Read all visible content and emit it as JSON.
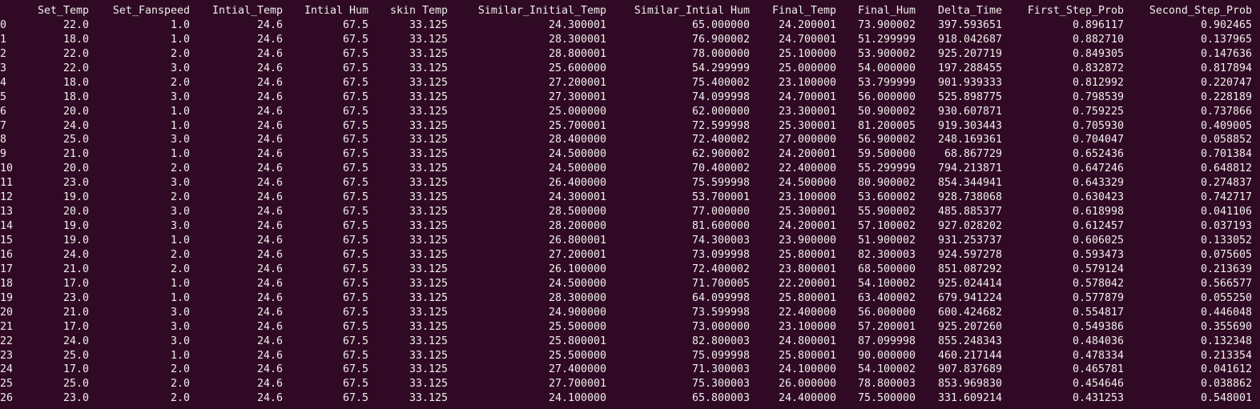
{
  "terminal": {
    "columns": [
      "Set_Temp",
      "Set_Fanspeed",
      "Intial_Temp",
      "Intial Hum",
      "skin Temp",
      "Similar_Initial_Temp",
      "Similar_Intial Hum",
      "Final_Temp",
      "Final_Hum",
      "Delta_Time",
      "First_Step_Prob",
      "Second_Step_Prob"
    ],
    "rows": [
      [
        "0",
        "22.0",
        "1.0",
        "24.6",
        "67.5",
        "33.125",
        "24.300001",
        "65.000000",
        "24.200001",
        "73.900002",
        "397.593651",
        "0.896117",
        "0.902465"
      ],
      [
        "1",
        "18.0",
        "1.0",
        "24.6",
        "67.5",
        "33.125",
        "28.300001",
        "76.900002",
        "24.700001",
        "51.299999",
        "918.042687",
        "0.882710",
        "0.137965"
      ],
      [
        "2",
        "22.0",
        "2.0",
        "24.6",
        "67.5",
        "33.125",
        "28.800001",
        "78.000000",
        "25.100000",
        "53.900002",
        "925.207719",
        "0.849305",
        "0.147636"
      ],
      [
        "3",
        "22.0",
        "3.0",
        "24.6",
        "67.5",
        "33.125",
        "25.600000",
        "54.299999",
        "25.000000",
        "54.000000",
        "197.288455",
        "0.832872",
        "0.817894"
      ],
      [
        "4",
        "18.0",
        "2.0",
        "24.6",
        "67.5",
        "33.125",
        "27.200001",
        "75.400002",
        "23.100000",
        "53.799999",
        "901.939333",
        "0.812992",
        "0.220747"
      ],
      [
        "5",
        "18.0",
        "3.0",
        "24.6",
        "67.5",
        "33.125",
        "27.300001",
        "74.099998",
        "24.700001",
        "56.000000",
        "525.898775",
        "0.798539",
        "0.228189"
      ],
      [
        "6",
        "20.0",
        "1.0",
        "24.6",
        "67.5",
        "33.125",
        "25.000000",
        "62.000000",
        "23.300001",
        "50.900002",
        "930.607871",
        "0.759225",
        "0.737866"
      ],
      [
        "7",
        "24.0",
        "1.0",
        "24.6",
        "67.5",
        "33.125",
        "25.700001",
        "72.599998",
        "25.300001",
        "81.200005",
        "919.303443",
        "0.705930",
        "0.409005"
      ],
      [
        "8",
        "25.0",
        "3.0",
        "24.6",
        "67.5",
        "33.125",
        "28.400000",
        "72.400002",
        "27.000000",
        "56.900002",
        "248.169361",
        "0.704047",
        "0.058852"
      ],
      [
        "9",
        "21.0",
        "1.0",
        "24.6",
        "67.5",
        "33.125",
        "24.500000",
        "62.900002",
        "24.200001",
        "59.500000",
        " 68.867729",
        "0.652436",
        "0.701384"
      ],
      [
        "10",
        "20.0",
        "2.0",
        "24.6",
        "67.5",
        "33.125",
        "24.500000",
        "70.400002",
        "22.400000",
        "55.299999",
        "794.213871",
        "0.647246",
        "0.648812"
      ],
      [
        "11",
        "23.0",
        "3.0",
        "24.6",
        "67.5",
        "33.125",
        "26.400000",
        "75.599998",
        "24.500000",
        "80.900002",
        "854.344941",
        "0.643329",
        "0.274837"
      ],
      [
        "12",
        "19.0",
        "2.0",
        "24.6",
        "67.5",
        "33.125",
        "24.300001",
        "53.700001",
        "23.100000",
        "53.600002",
        "928.738068",
        "0.630423",
        "0.742717"
      ],
      [
        "13",
        "20.0",
        "3.0",
        "24.6",
        "67.5",
        "33.125",
        "28.500000",
        "77.000000",
        "25.300001",
        "55.900002",
        "485.885377",
        "0.618998",
        "0.041106"
      ],
      [
        "14",
        "19.0",
        "3.0",
        "24.6",
        "67.5",
        "33.125",
        "28.200000",
        "81.600000",
        "24.200001",
        "57.100002",
        "927.028202",
        "0.612457",
        "0.037193"
      ],
      [
        "15",
        "19.0",
        "1.0",
        "24.6",
        "67.5",
        "33.125",
        "26.800001",
        "74.300003",
        "23.900000",
        "51.900002",
        "931.253737",
        "0.606025",
        "0.133052"
      ],
      [
        "16",
        "24.0",
        "2.0",
        "24.6",
        "67.5",
        "33.125",
        "27.200001",
        "73.099998",
        "25.800001",
        "82.300003",
        "924.597278",
        "0.593473",
        "0.075605"
      ],
      [
        "17",
        "21.0",
        "2.0",
        "24.6",
        "67.5",
        "33.125",
        "26.100000",
        "72.400002",
        "23.800001",
        "68.500000",
        "851.087292",
        "0.579124",
        "0.213639"
      ],
      [
        "18",
        "17.0",
        "1.0",
        "24.6",
        "67.5",
        "33.125",
        "24.500000",
        "71.700005",
        "22.200001",
        "54.100002",
        "925.024414",
        "0.578042",
        "0.566577"
      ],
      [
        "19",
        "23.0",
        "1.0",
        "24.6",
        "67.5",
        "33.125",
        "28.300000",
        "64.099998",
        "25.800001",
        "63.400002",
        "679.941224",
        "0.577879",
        "0.055250"
      ],
      [
        "20",
        "21.0",
        "3.0",
        "24.6",
        "67.5",
        "33.125",
        "24.900000",
        "73.599998",
        "22.400000",
        "56.000000",
        "600.424682",
        "0.554817",
        "0.446048"
      ],
      [
        "21",
        "17.0",
        "3.0",
        "24.6",
        "67.5",
        "33.125",
        "25.500000",
        "73.000000",
        "23.100000",
        "57.200001",
        "925.207260",
        "0.549386",
        "0.355690"
      ],
      [
        "22",
        "24.0",
        "3.0",
        "24.6",
        "67.5",
        "33.125",
        "25.800001",
        "82.800003",
        "24.800001",
        "87.099998",
        "855.248343",
        "0.484036",
        "0.132348"
      ],
      [
        "23",
        "25.0",
        "1.0",
        "24.6",
        "67.5",
        "33.125",
        "25.500000",
        "75.099998",
        "25.800001",
        "90.000000",
        "460.217144",
        "0.478334",
        "0.213354"
      ],
      [
        "24",
        "17.0",
        "2.0",
        "24.6",
        "67.5",
        "33.125",
        "27.400000",
        "71.300003",
        "24.100000",
        "54.100002",
        "907.837689",
        "0.465781",
        "0.041612"
      ],
      [
        "25",
        "25.0",
        "2.0",
        "24.6",
        "67.5",
        "33.125",
        "27.700001",
        "75.300003",
        "26.000000",
        "78.800003",
        "853.969830",
        "0.454646",
        "0.038862"
      ],
      [
        "26",
        "23.0",
        "2.0",
        "24.6",
        "67.5",
        "33.125",
        "24.100000",
        "65.800003",
        "24.400000",
        "75.500000",
        "331.609214",
        "0.431253",
        "0.548001"
      ]
    ]
  }
}
